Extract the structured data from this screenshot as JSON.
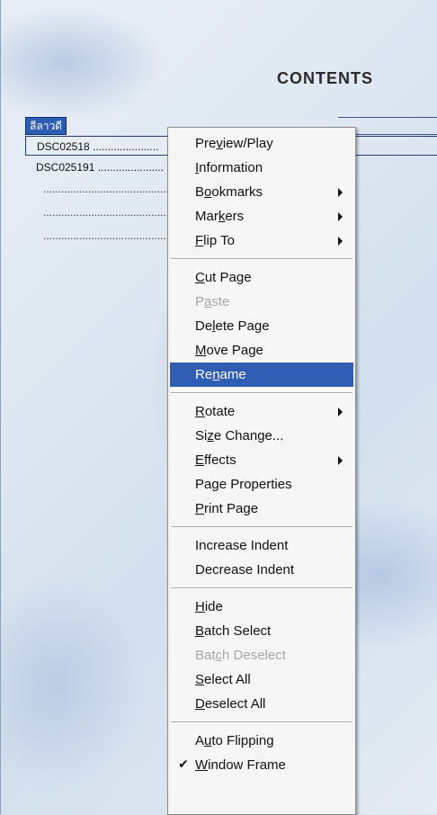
{
  "header": {
    "title": "CONTENTS"
  },
  "tree": {
    "title_item": "ลีลาวดี",
    "items": [
      {
        "label": "DSC02518 ......................"
      },
      {
        "label": "DSC025191 ......................"
      }
    ],
    "empty_rows": [
      "......................................................",
      "......................................................",
      "......................................................"
    ]
  },
  "context_menu": {
    "groups": [
      [
        {
          "pre": "Pre",
          "key": "v",
          "post": "iew/Play",
          "submenu": false,
          "disabled": false
        },
        {
          "pre": "",
          "key": "I",
          "post": "nformation",
          "submenu": false,
          "disabled": false
        },
        {
          "pre": "B",
          "key": "o",
          "post": "okmarks",
          "submenu": true,
          "disabled": false
        },
        {
          "pre": "Mar",
          "key": "k",
          "post": "ers",
          "submenu": true,
          "disabled": false
        },
        {
          "pre": "",
          "key": "F",
          "post": "lip To",
          "submenu": true,
          "disabled": false
        }
      ],
      [
        {
          "pre": "",
          "key": "C",
          "post": "ut Page",
          "submenu": false,
          "disabled": false
        },
        {
          "pre": "P",
          "key": "a",
          "post": "ste",
          "submenu": false,
          "disabled": true
        },
        {
          "pre": "De",
          "key": "l",
          "post": "ete Page",
          "submenu": false,
          "disabled": false
        },
        {
          "pre": "",
          "key": "M",
          "post": "ove Page",
          "submenu": false,
          "disabled": false
        },
        {
          "pre": "Re",
          "key": "n",
          "post": "ame",
          "submenu": false,
          "disabled": false,
          "highlight": true
        }
      ],
      [
        {
          "pre": "",
          "key": "R",
          "post": "otate",
          "submenu": true,
          "disabled": false
        },
        {
          "pre": "Si",
          "key": "z",
          "post": "e Change...",
          "submenu": false,
          "disabled": false
        },
        {
          "pre": "",
          "key": "E",
          "post": "ffects",
          "submenu": true,
          "disabled": false
        },
        {
          "pre": "Pa",
          "key": "g",
          "post": "e Properties",
          "submenu": false,
          "disabled": false
        },
        {
          "pre": "",
          "key": "P",
          "post": "rint Page",
          "submenu": false,
          "disabled": false
        }
      ],
      [
        {
          "pre": "Increase Indent",
          "key": "",
          "post": "",
          "submenu": false,
          "disabled": false
        },
        {
          "pre": "Decrease Indent",
          "key": "",
          "post": "",
          "submenu": false,
          "disabled": false
        }
      ],
      [
        {
          "pre": "",
          "key": "H",
          "post": "ide",
          "submenu": false,
          "disabled": false
        },
        {
          "pre": "",
          "key": "B",
          "post": "atch Select",
          "submenu": false,
          "disabled": false
        },
        {
          "pre": "Bat",
          "key": "c",
          "post": "h Deselect",
          "submenu": false,
          "disabled": true
        },
        {
          "pre": "",
          "key": "S",
          "post": "elect All",
          "submenu": false,
          "disabled": false
        },
        {
          "pre": "",
          "key": "D",
          "post": "eselect All",
          "submenu": false,
          "disabled": false
        }
      ],
      [
        {
          "pre": "A",
          "key": "u",
          "post": "to Flipping",
          "submenu": false,
          "disabled": false
        },
        {
          "pre": "",
          "key": "W",
          "post": "indow Frame",
          "submenu": false,
          "disabled": false,
          "checked": true
        }
      ]
    ],
    "check_glyph": "✔"
  },
  "colors": {
    "highlight": "#2f5db3",
    "disabled_text": "#a7a7a7"
  }
}
